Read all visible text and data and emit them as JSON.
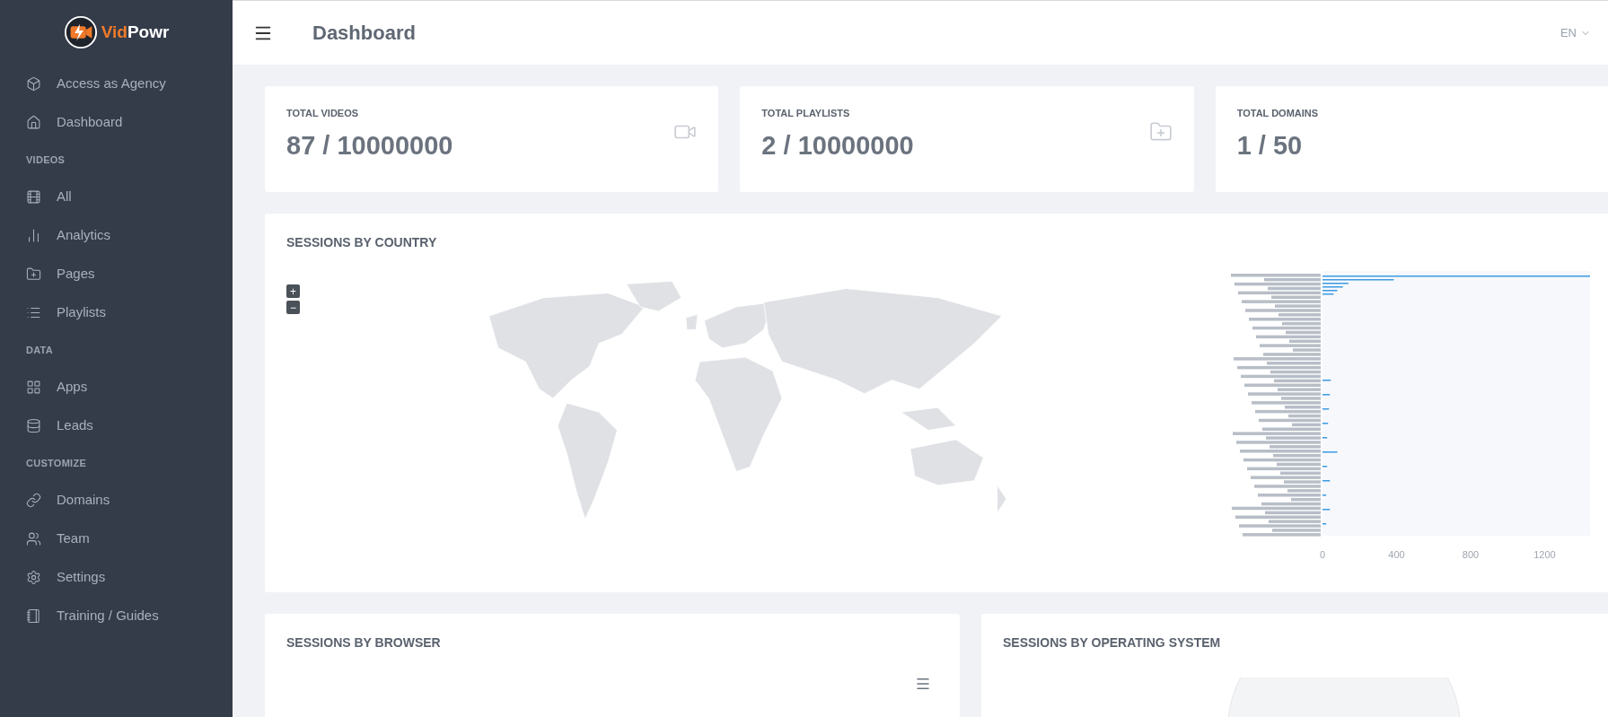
{
  "sidebar": {
    "logo_text": {
      "first": "Vid",
      "second": "Powr"
    },
    "sections": [
      {
        "items": [
          {
            "label": "Access as Agency"
          },
          {
            "label": "Dashboard"
          }
        ]
      },
      {
        "heading": "VIDEOS",
        "items": [
          {
            "label": "All"
          },
          {
            "label": "Analytics"
          },
          {
            "label": "Pages"
          },
          {
            "label": "Playlists"
          }
        ]
      },
      {
        "heading": "DATA",
        "items": [
          {
            "label": "Apps"
          },
          {
            "label": "Leads"
          }
        ]
      },
      {
        "heading": "CUSTOMIZE",
        "items": [
          {
            "label": "Domains"
          },
          {
            "label": "Team"
          },
          {
            "label": "Settings"
          },
          {
            "label": "Training / Guides"
          }
        ]
      }
    ]
  },
  "header": {
    "title": "Dashboard",
    "language": "EN"
  },
  "stats": [
    {
      "label": "TOTAL VIDEOS",
      "value": "87 / 10000000"
    },
    {
      "label": "TOTAL PLAYLISTS",
      "value": "2 / 10000000"
    },
    {
      "label": "TOTAL DOMAINS",
      "value": "1 / 50"
    }
  ],
  "country_panel": {
    "title": "SESSIONS BY COUNTRY",
    "zoom_in": "+",
    "zoom_out": "−",
    "axis_ticks": [
      "0",
      "400",
      "800",
      "1200"
    ]
  },
  "browser_panel": {
    "title": "SESSIONS BY BROWSER"
  },
  "os_panel": {
    "title": "SESSIONS BY OPERATING SYSTEM"
  }
}
